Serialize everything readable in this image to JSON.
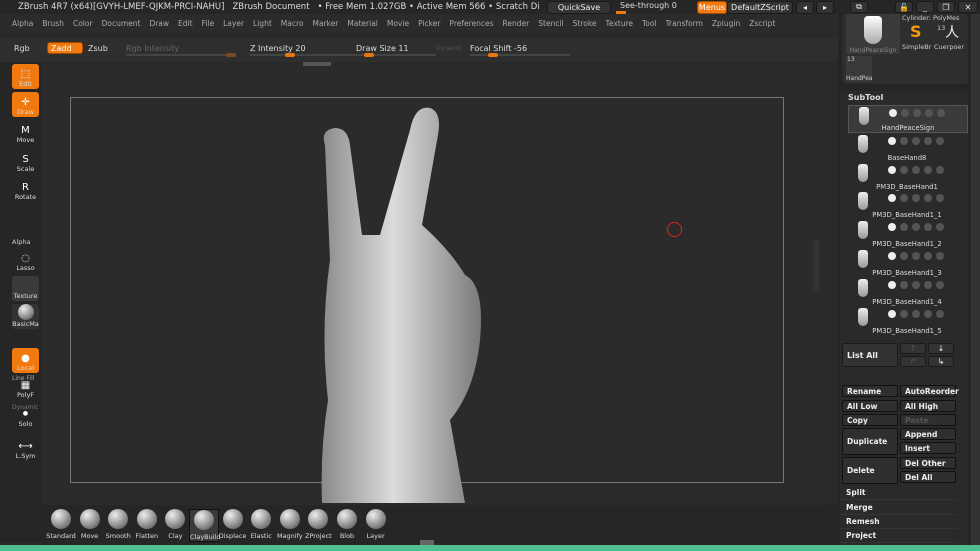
{
  "titlebar": {
    "app": "ZBrush 4R7 (x64)[GVYH-LMEF-QJKM-PRCI-NAHU]",
    "doc": "ZBrush Document",
    "mem": "• Free Mem 1.027GB • Active Mem 566 • Scratch Di",
    "quicksave": "QuickSave",
    "seethrough": "See-through  0",
    "menus": "Menus",
    "script": "DefaultZScript"
  },
  "menu": [
    "Alpha",
    "Brush",
    "Color",
    "Document",
    "Draw",
    "Edit",
    "File",
    "Layer",
    "Light",
    "Macro",
    "Marker",
    "Material",
    "Movie",
    "Picker",
    "Preferences",
    "Render",
    "Stencil",
    "Stroke",
    "Texture",
    "Tool",
    "Transform",
    "Zplugin",
    "Zscript"
  ],
  "toolbar": {
    "rgb": "Rgb",
    "zadd": "Zadd",
    "zsub": "Zsub",
    "rgb_intensity": "Rgb Intensity",
    "z_intensity": "Z Intensity 20",
    "draw_size": "Draw Size 11",
    "dynamic": "Dynamic",
    "focal_shift": "Focal Shift -56"
  },
  "left": {
    "edit": "Edit",
    "draw": "Draw",
    "move": "Move",
    "scale": "Scale",
    "rotate": "Rotate",
    "alpha": "Alpha",
    "lasso": "Lasso",
    "texture": "Texture",
    "material": "BasicMa",
    "local": "Local",
    "polyf": "PolyF",
    "line_fill": "Line Fill",
    "dynamic": "Dynamic",
    "solo": "Solo",
    "lsym": "L.Sym"
  },
  "brushes": [
    "Standard",
    "Move",
    "Smooth",
    "Flatten",
    "Clay",
    "ClayBuild",
    "Displace",
    "Elastic",
    "Magnify",
    "ZProject",
    "Blob",
    "Layer"
  ],
  "tool_palette": {
    "current": "HandPeaceSign",
    "cylinder": "Cylinder: PolyMes",
    "simple": "SimpleBr",
    "cuerpo": "Cuerpoer",
    "handpea": "HandPea",
    "count1": "13",
    "count2": "13"
  },
  "subtool": {
    "title": "SubTool",
    "items": [
      "HandPeaceSign",
      "BaseHand8",
      "PM3D_BaseHand1",
      "PM3D_BaseHand1_1",
      "PM3D_BaseHand1_2",
      "PM3D_BaseHand1_3",
      "PM3D_BaseHand1_4",
      "PM3D_BaseHand1_5"
    ],
    "list_all": "List All",
    "rename": "Rename",
    "autoreorder": "AutoReorder",
    "all_low": "All Low",
    "all_high": "All High",
    "copy": "Copy",
    "paste": "Paste",
    "duplicate": "Duplicate",
    "append": "Append",
    "insert": "Insert",
    "delete": "Delete",
    "del_other": "Del Other",
    "del_all": "Del All",
    "split": "Split",
    "merge": "Merge",
    "remesh": "Remesh",
    "project": "Project"
  },
  "colors": {
    "accent": "#f07a10",
    "border": "#4fbf8e"
  }
}
